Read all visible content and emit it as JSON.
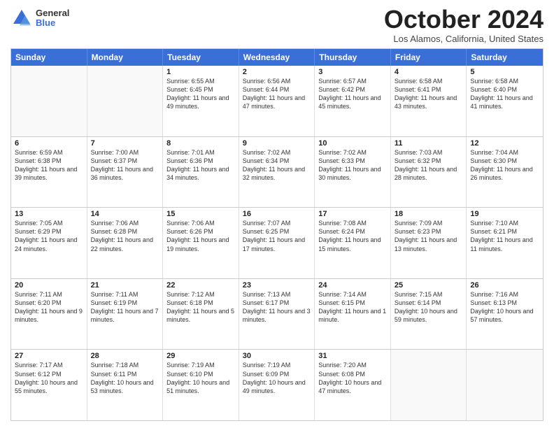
{
  "header": {
    "logo": {
      "general": "General",
      "blue": "Blue"
    },
    "title": "October 2024",
    "location": "Los Alamos, California, United States"
  },
  "days_of_week": [
    "Sunday",
    "Monday",
    "Tuesday",
    "Wednesday",
    "Thursday",
    "Friday",
    "Saturday"
  ],
  "weeks": [
    [
      {
        "day": "",
        "info": ""
      },
      {
        "day": "",
        "info": ""
      },
      {
        "day": "1",
        "info": "Sunrise: 6:55 AM\nSunset: 6:45 PM\nDaylight: 11 hours and 49 minutes."
      },
      {
        "day": "2",
        "info": "Sunrise: 6:56 AM\nSunset: 6:44 PM\nDaylight: 11 hours and 47 minutes."
      },
      {
        "day": "3",
        "info": "Sunrise: 6:57 AM\nSunset: 6:42 PM\nDaylight: 11 hours and 45 minutes."
      },
      {
        "day": "4",
        "info": "Sunrise: 6:58 AM\nSunset: 6:41 PM\nDaylight: 11 hours and 43 minutes."
      },
      {
        "day": "5",
        "info": "Sunrise: 6:58 AM\nSunset: 6:40 PM\nDaylight: 11 hours and 41 minutes."
      }
    ],
    [
      {
        "day": "6",
        "info": "Sunrise: 6:59 AM\nSunset: 6:38 PM\nDaylight: 11 hours and 39 minutes."
      },
      {
        "day": "7",
        "info": "Sunrise: 7:00 AM\nSunset: 6:37 PM\nDaylight: 11 hours and 36 minutes."
      },
      {
        "day": "8",
        "info": "Sunrise: 7:01 AM\nSunset: 6:36 PM\nDaylight: 11 hours and 34 minutes."
      },
      {
        "day": "9",
        "info": "Sunrise: 7:02 AM\nSunset: 6:34 PM\nDaylight: 11 hours and 32 minutes."
      },
      {
        "day": "10",
        "info": "Sunrise: 7:02 AM\nSunset: 6:33 PM\nDaylight: 11 hours and 30 minutes."
      },
      {
        "day": "11",
        "info": "Sunrise: 7:03 AM\nSunset: 6:32 PM\nDaylight: 11 hours and 28 minutes."
      },
      {
        "day": "12",
        "info": "Sunrise: 7:04 AM\nSunset: 6:30 PM\nDaylight: 11 hours and 26 minutes."
      }
    ],
    [
      {
        "day": "13",
        "info": "Sunrise: 7:05 AM\nSunset: 6:29 PM\nDaylight: 11 hours and 24 minutes."
      },
      {
        "day": "14",
        "info": "Sunrise: 7:06 AM\nSunset: 6:28 PM\nDaylight: 11 hours and 22 minutes."
      },
      {
        "day": "15",
        "info": "Sunrise: 7:06 AM\nSunset: 6:26 PM\nDaylight: 11 hours and 19 minutes."
      },
      {
        "day": "16",
        "info": "Sunrise: 7:07 AM\nSunset: 6:25 PM\nDaylight: 11 hours and 17 minutes."
      },
      {
        "day": "17",
        "info": "Sunrise: 7:08 AM\nSunset: 6:24 PM\nDaylight: 11 hours and 15 minutes."
      },
      {
        "day": "18",
        "info": "Sunrise: 7:09 AM\nSunset: 6:23 PM\nDaylight: 11 hours and 13 minutes."
      },
      {
        "day": "19",
        "info": "Sunrise: 7:10 AM\nSunset: 6:21 PM\nDaylight: 11 hours and 11 minutes."
      }
    ],
    [
      {
        "day": "20",
        "info": "Sunrise: 7:11 AM\nSunset: 6:20 PM\nDaylight: 11 hours and 9 minutes."
      },
      {
        "day": "21",
        "info": "Sunrise: 7:11 AM\nSunset: 6:19 PM\nDaylight: 11 hours and 7 minutes."
      },
      {
        "day": "22",
        "info": "Sunrise: 7:12 AM\nSunset: 6:18 PM\nDaylight: 11 hours and 5 minutes."
      },
      {
        "day": "23",
        "info": "Sunrise: 7:13 AM\nSunset: 6:17 PM\nDaylight: 11 hours and 3 minutes."
      },
      {
        "day": "24",
        "info": "Sunrise: 7:14 AM\nSunset: 6:15 PM\nDaylight: 11 hours and 1 minute."
      },
      {
        "day": "25",
        "info": "Sunrise: 7:15 AM\nSunset: 6:14 PM\nDaylight: 10 hours and 59 minutes."
      },
      {
        "day": "26",
        "info": "Sunrise: 7:16 AM\nSunset: 6:13 PM\nDaylight: 10 hours and 57 minutes."
      }
    ],
    [
      {
        "day": "27",
        "info": "Sunrise: 7:17 AM\nSunset: 6:12 PM\nDaylight: 10 hours and 55 minutes."
      },
      {
        "day": "28",
        "info": "Sunrise: 7:18 AM\nSunset: 6:11 PM\nDaylight: 10 hours and 53 minutes."
      },
      {
        "day": "29",
        "info": "Sunrise: 7:19 AM\nSunset: 6:10 PM\nDaylight: 10 hours and 51 minutes."
      },
      {
        "day": "30",
        "info": "Sunrise: 7:19 AM\nSunset: 6:09 PM\nDaylight: 10 hours and 49 minutes."
      },
      {
        "day": "31",
        "info": "Sunrise: 7:20 AM\nSunset: 6:08 PM\nDaylight: 10 hours and 47 minutes."
      },
      {
        "day": "",
        "info": ""
      },
      {
        "day": "",
        "info": ""
      }
    ]
  ]
}
